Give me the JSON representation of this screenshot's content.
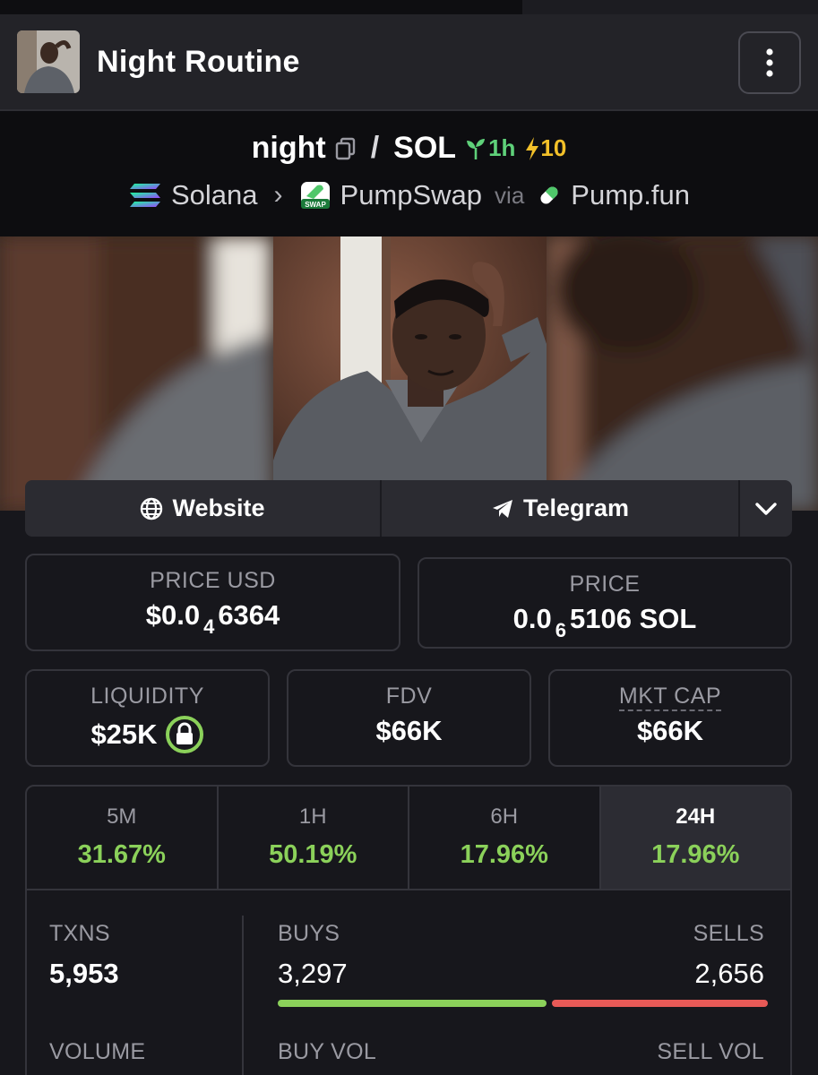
{
  "header": {
    "title": "Night Routine"
  },
  "pair": {
    "base": "night",
    "quote": "SOL",
    "age": "1h",
    "boosts": "10",
    "chain": "Solana",
    "dex": "PumpSwap",
    "dex_badge": "SWAP",
    "via_label": "via",
    "launchpad": "Pump.fun"
  },
  "links": {
    "website": "Website",
    "telegram": "Telegram"
  },
  "prices": {
    "usd_label": "PRICE USD",
    "usd_prefix": "$0.0",
    "usd_sub": "4",
    "usd_digits": "6364",
    "native_label": "PRICE",
    "native_prefix": "0.0",
    "native_sub": "6",
    "native_digits": "5106 SOL"
  },
  "metrics": {
    "liquidity_label": "LIQUIDITY",
    "liquidity": "$25K",
    "fdv_label": "FDV",
    "fdv": "$66K",
    "mcap_label": "MKT CAP",
    "mcap": "$66K"
  },
  "changes": [
    {
      "label": "5M",
      "value": "31.67%"
    },
    {
      "label": "1H",
      "value": "50.19%"
    },
    {
      "label": "6H",
      "value": "17.96%"
    },
    {
      "label": "24H",
      "value": "17.96%"
    }
  ],
  "stats": {
    "txns_label": "TXNS",
    "txns": "5,953",
    "buys_label": "BUYS",
    "buys": "3,297",
    "sells_label": "SELLS",
    "sells": "2,656",
    "buy_share": 0.554,
    "volume_label": "VOLUME",
    "buy_vol_label": "BUY VOL",
    "sell_vol_label": "SELL VOL"
  },
  "colors": {
    "positive": "#8bd15a",
    "negative": "#e85a57",
    "age": "#5fd17a",
    "boost": "#f2c029"
  }
}
